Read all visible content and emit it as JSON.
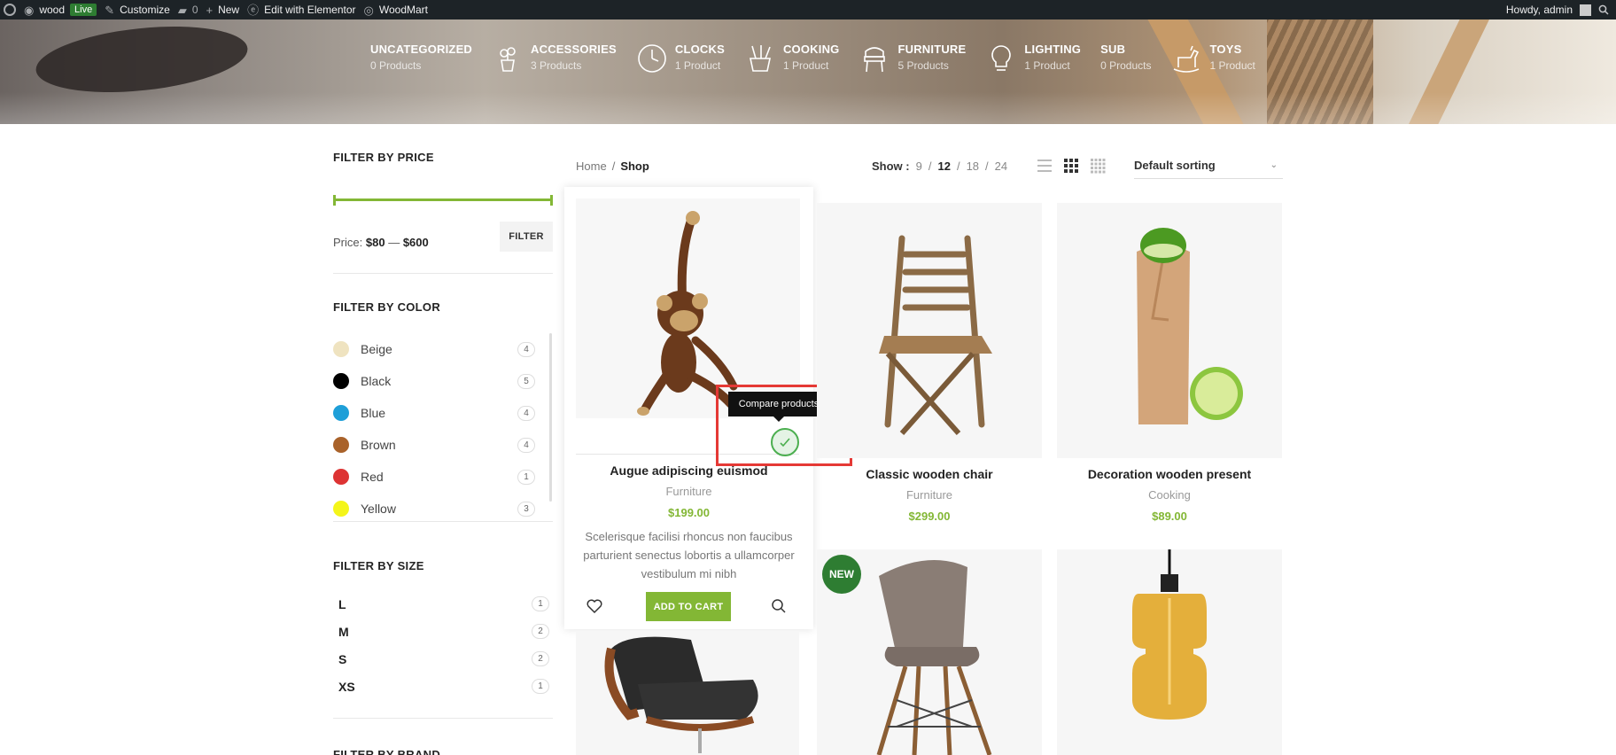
{
  "admin_bar": {
    "site_name": "wood",
    "live_label": "Live",
    "customize": "Customize",
    "comments_count": "0",
    "new_label": "New",
    "elementor": "Edit with Elementor",
    "woodmart": "WoodMart",
    "howdy": "Howdy, admin"
  },
  "categories": [
    {
      "name": "UNCATEGORIZED",
      "count": "0 Products",
      "icon": "none-icon"
    },
    {
      "name": "ACCESSORIES",
      "count": "3 Products",
      "icon": "plant-icon"
    },
    {
      "name": "CLOCKS",
      "count": "1 Product",
      "icon": "clock-icon"
    },
    {
      "name": "COOKING",
      "count": "1 Product",
      "icon": "utensils-icon"
    },
    {
      "name": "FURNITURE",
      "count": "5 Products",
      "icon": "chair-icon"
    },
    {
      "name": "LIGHTING",
      "count": "1 Product",
      "icon": "bulb-icon"
    },
    {
      "name": "SUB",
      "count": "0 Products",
      "icon": "none-icon"
    },
    {
      "name": "TOYS",
      "count": "1 Product",
      "icon": "rocking-horse-icon"
    }
  ],
  "sidebar": {
    "price": {
      "title": "FILTER BY PRICE",
      "label": "Price:",
      "min": "$80",
      "dash": "—",
      "max": "$600",
      "filter_button": "FILTER"
    },
    "color": {
      "title": "FILTER BY COLOR",
      "items": [
        {
          "name": "Beige",
          "count": "4",
          "hex": "#efe3c0"
        },
        {
          "name": "Black",
          "count": "5",
          "hex": "#000000"
        },
        {
          "name": "Blue",
          "count": "4",
          "hex": "#1e9fd8"
        },
        {
          "name": "Brown",
          "count": "4",
          "hex": "#a9622a"
        },
        {
          "name": "Red",
          "count": "1",
          "hex": "#dd3333"
        },
        {
          "name": "Yellow",
          "count": "3",
          "hex": "#f4f51a"
        }
      ]
    },
    "size": {
      "title": "FILTER BY SIZE",
      "items": [
        {
          "name": "L",
          "count": "1"
        },
        {
          "name": "M",
          "count": "2"
        },
        {
          "name": "S",
          "count": "2"
        },
        {
          "name": "XS",
          "count": "1"
        }
      ]
    },
    "brand_title": "FILTER BY BRAND"
  },
  "breadcrumb": {
    "home": "Home",
    "separator": "/",
    "current": "Shop"
  },
  "per_page": {
    "label": "Show :",
    "options": [
      "9",
      "12",
      "18",
      "24"
    ],
    "active": "12",
    "separator": "/"
  },
  "sort": {
    "selected": "Default sorting"
  },
  "products": [
    {
      "title": "Augue adipiscing euismod",
      "category": "Furniture",
      "price": "$199.00",
      "description": "Scelerisque facilisi rhoncus non faucibus parturient senectus lobortis a ullamcorper vestibulum mi nibh",
      "add_to_cart": "ADD TO CART"
    },
    {
      "title": "Classic wooden chair",
      "category": "Furniture",
      "price": "$299.00"
    },
    {
      "title": "Decoration wooden present",
      "category": "Cooking",
      "price": "$89.00"
    }
  ],
  "tooltip": "Compare products",
  "new_badge": "NEW",
  "colors": {
    "accent": "#83b735",
    "admin_bar": "#1d2327",
    "highlight": "#e53935"
  }
}
